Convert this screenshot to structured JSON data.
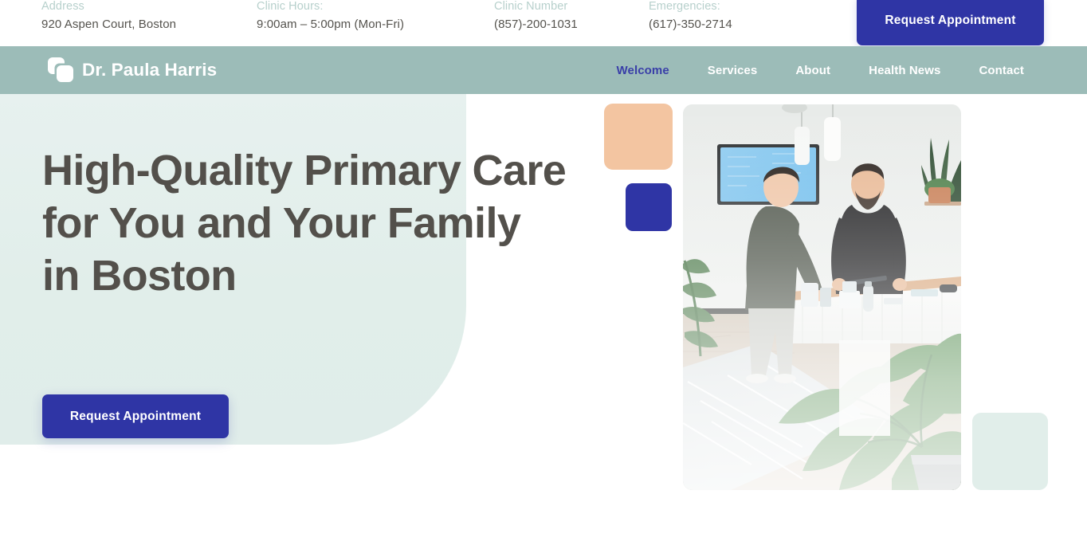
{
  "topbar": {
    "contacts": [
      {
        "label": "Address",
        "value": "920 Aspen Court, Boston"
      },
      {
        "label": "Clinic Hours:",
        "value": "9:00am – 5:00pm (Mon-Fri)"
      },
      {
        "label": "Clinic Number",
        "value": "(857)-200-1031"
      },
      {
        "label": "Emergencies:",
        "value": "(617)-350-2714"
      }
    ],
    "cta_label": "Request Appointment"
  },
  "nav": {
    "brand_name": "Dr. Paula Harris",
    "links": [
      {
        "label": "Welcome",
        "active": true
      },
      {
        "label": "Services",
        "active": false
      },
      {
        "label": "About",
        "active": false
      },
      {
        "label": "Health News",
        "active": false
      },
      {
        "label": "Contact",
        "active": false
      }
    ]
  },
  "hero": {
    "heading": "High-Quality Primary Care for You and Your Family in Boston",
    "cta_label": "Request Appointment",
    "photo_alt": "Clinic reception desk with patient and staff member"
  },
  "colors": {
    "nav_bg": "#9cbcb8",
    "accent_indigo": "#2f35a5",
    "mint_panel": "#e1eeea",
    "peach": "#f3c5a1",
    "heading_text": "#53504b",
    "label_text": "#b7d0cc"
  }
}
